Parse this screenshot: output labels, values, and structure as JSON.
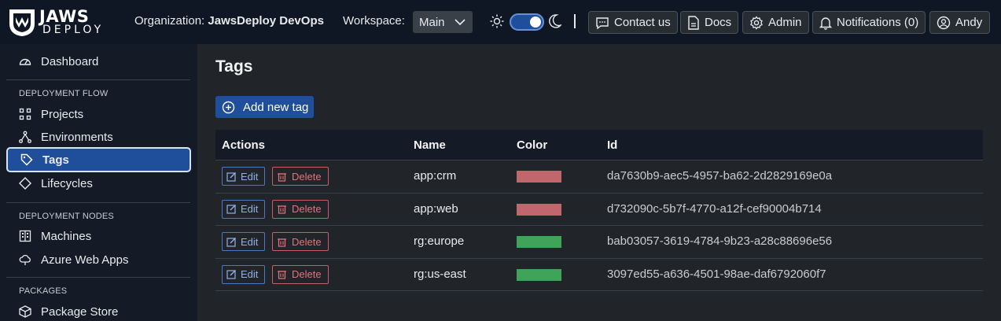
{
  "header": {
    "logo_main": "JAWS",
    "logo_sub": "DEPLOY",
    "org_label": "Organization:",
    "org_name": "JawsDeploy DevOps",
    "workspace_label": "Workspace:",
    "workspace_value": "Main",
    "theme_toggle_on": true,
    "buttons": {
      "contact": "Contact us",
      "docs": "Docs",
      "admin": "Admin",
      "notifications": "Notifications (0)",
      "user": "Andy"
    }
  },
  "sidebar": {
    "dashboard": "Dashboard",
    "section_flow": "DEPLOYMENT FLOW",
    "projects": "Projects",
    "environments": "Environments",
    "tags": "Tags",
    "lifecycles": "Lifecycles",
    "section_nodes": "DEPLOYMENT NODES",
    "machines": "Machines",
    "azure": "Azure Web Apps",
    "section_packages": "PACKAGES",
    "package_store": "Package Store",
    "active": "Tags"
  },
  "main": {
    "title": "Tags",
    "add_button": "Add new tag",
    "columns": {
      "actions": "Actions",
      "name": "Name",
      "color": "Color",
      "id": "Id"
    },
    "edit_label": "Edit",
    "delete_label": "Delete",
    "rows": [
      {
        "name": "app:crm",
        "color": "#c0666d",
        "id": "da7630b9-aec5-4957-ba62-2d2829169e0a"
      },
      {
        "name": "app:web",
        "color": "#c0666d",
        "id": "d732090c-5b7f-4770-a12f-cef90004b714"
      },
      {
        "name": "rg:europe",
        "color": "#3fa45a",
        "id": "bab03057-3619-4784-9b23-a28c88696e56"
      },
      {
        "name": "rg:us-east",
        "color": "#3fa45a",
        "id": "3097ed55-a636-4501-98ae-daf6792060f7"
      }
    ]
  },
  "colors": {
    "accent": "#1f4e9a",
    "topbar": "#0f1724",
    "sidebar": "#151b26",
    "content": "#212529"
  }
}
